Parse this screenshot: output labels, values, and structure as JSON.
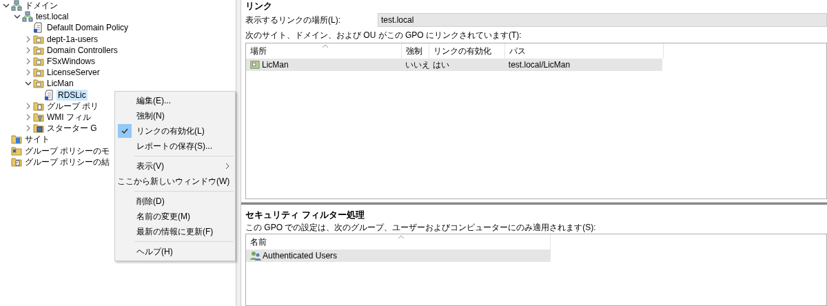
{
  "tree": [
    {
      "label": "ドメイン",
      "kind": "domains",
      "expanded": true,
      "children": [
        {
          "label": "test.local",
          "kind": "domain",
          "expanded": true,
          "children": [
            {
              "label": "Default Domain Policy",
              "kind": "gpo"
            },
            {
              "label": "dept-1a-users",
              "kind": "ou",
              "expanded": false
            },
            {
              "label": "Domain Controllers",
              "kind": "ou",
              "expanded": false
            },
            {
              "label": "FSxWindows",
              "kind": "ou",
              "expanded": false
            },
            {
              "label": "LicenseServer",
              "kind": "ou",
              "expanded": false
            },
            {
              "label": "LicMan",
              "kind": "ou",
              "expanded": true,
              "children": [
                {
                  "label": "RDSLic",
                  "kind": "gpo",
                  "selected": true
                }
              ]
            },
            {
              "label": "グループ ポリ",
              "kind": "gpo-folder",
              "expanded": false
            },
            {
              "label": "WMI フィル",
              "kind": "wmi",
              "expanded": false
            },
            {
              "label": "スターター G",
              "kind": "starter",
              "expanded": false
            }
          ]
        }
      ]
    },
    {
      "label": "サイト",
      "kind": "site"
    },
    {
      "label": "グループ ポリシーのモ",
      "kind": "modeling"
    },
    {
      "label": "グループ ポリシーの結",
      "kind": "results"
    }
  ],
  "context_menu": [
    {
      "kind": "item",
      "label": "編集(E)...",
      "checked": false
    },
    {
      "kind": "item",
      "label": "強制(N)",
      "checked": false
    },
    {
      "kind": "item",
      "label": "リンクの有効化(L)",
      "checked": true
    },
    {
      "kind": "item",
      "label": "レポートの保存(S)...",
      "checked": false
    },
    {
      "kind": "separator"
    },
    {
      "kind": "submenu",
      "label": "表示(V)",
      "checked": false
    },
    {
      "kind": "item",
      "label": "ここから新しいウィンドウ(W)",
      "checked": false
    },
    {
      "kind": "separator"
    },
    {
      "kind": "item",
      "label": "削除(D)",
      "checked": false
    },
    {
      "kind": "item",
      "label": "名前の変更(M)",
      "checked": false
    },
    {
      "kind": "item",
      "label": "最新の情報に更新(F)",
      "checked": false
    },
    {
      "kind": "separator"
    },
    {
      "kind": "item",
      "label": "ヘルプ(H)",
      "checked": false
    }
  ],
  "links": {
    "title": "リンク",
    "location_label": "表示するリンクの場所(L):",
    "location_value": "test.local",
    "description": "次のサイト、ドメイン、および OU がこの GPO にリンクされています(T):",
    "columns": [
      "場所",
      "強制",
      "リンクの有効化",
      "パス"
    ],
    "rows": [
      {
        "cells": [
          "LicMan",
          "いいえ",
          "はい",
          "test.local/LicMan"
        ],
        "selected": true
      }
    ]
  },
  "security_filtering": {
    "title": "セキュリティ フィルター処理",
    "description": "この GPO での設定は、次のグループ、ユーザーおよびコンピューターにのみ適用されます(S):",
    "columns": [
      "名前"
    ],
    "rows": [
      {
        "cells": [
          "Authenticated Users"
        ],
        "selected": true
      }
    ]
  }
}
